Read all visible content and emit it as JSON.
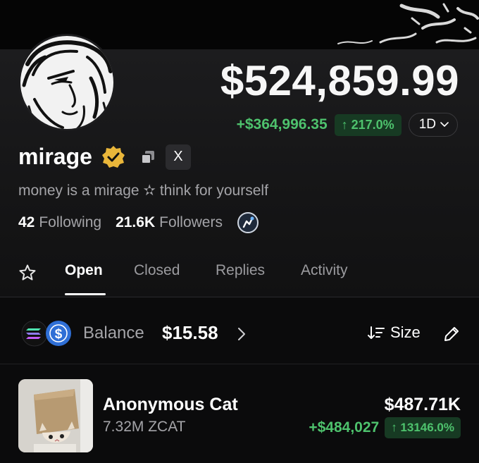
{
  "header": {
    "total_value": "$524,859.99",
    "pnl_value": "+$364,996.35",
    "pnl_percent": "↑ 217.0%",
    "range": "1D"
  },
  "profile": {
    "username": "mirage",
    "bio": "money is a mirage ✫ think for yourself",
    "following_count": "42",
    "following_label": "Following",
    "followers_count": "21.6K",
    "followers_label": "Followers",
    "x_label": "X"
  },
  "tabs": [
    {
      "label": "Open",
      "active": true
    },
    {
      "label": "Closed",
      "active": false
    },
    {
      "label": "Replies",
      "active": false
    },
    {
      "label": "Activity",
      "active": false
    }
  ],
  "balance": {
    "label": "Balance",
    "value": "$15.58",
    "sort_label": "Size"
  },
  "holdings": [
    {
      "name": "Anonymous Cat",
      "amount": "7.32M ZCAT",
      "value": "$487.71K",
      "pnl_value": "+$484,027",
      "pnl_percent": "↑ 13146.0%"
    }
  ],
  "colors": {
    "accent_green": "#4ec26d",
    "green_badge_bg": "#173a23",
    "verified_gold": "#e9b63a",
    "background": "#0b0b0c"
  },
  "icons": [
    "verified-badge-icon",
    "copy-icon",
    "x-logo-icon",
    "achievement-badge-icon",
    "star-icon",
    "solana-icon",
    "usdc-icon",
    "chevron-right-icon",
    "sort-icon",
    "edit-pencil-icon",
    "chevron-down-icon"
  ]
}
